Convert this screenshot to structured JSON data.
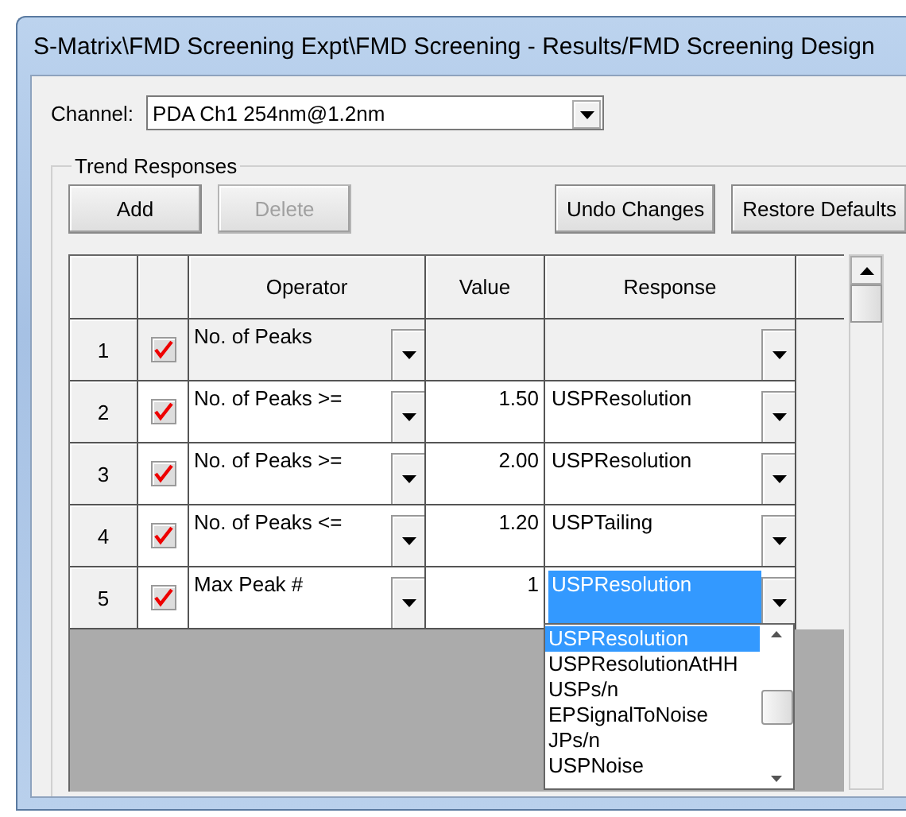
{
  "window": {
    "title": "S-Matrix\\FMD Screening Expt\\FMD Screening - Results/FMD Screening Design"
  },
  "channel": {
    "label": "Channel:",
    "value": "PDA Ch1 254nm@1.2nm"
  },
  "group": {
    "title": "Trend Responses"
  },
  "buttons": [
    {
      "label": "Add",
      "disabled": false
    },
    {
      "label": "Delete",
      "disabled": true
    },
    {
      "label": "Undo Changes",
      "disabled": false
    },
    {
      "label": "Restore Defaults",
      "disabled": false
    }
  ],
  "table": {
    "columns": [
      "Operator",
      "Value",
      "Response"
    ],
    "rows": [
      {
        "number": "1",
        "checked": true,
        "shaded": true,
        "operator": "No. of Peaks",
        "response_selected": false
      },
      {
        "number": "2",
        "checked": true,
        "shaded": false,
        "operator": "No. of Peaks >=",
        "value": "1.50",
        "response": "USPResolution",
        "response_selected": false
      },
      {
        "number": "3",
        "checked": true,
        "shaded": false,
        "operator": "No. of Peaks >=",
        "value": "2.00",
        "response": "USPResolution",
        "response_selected": false
      },
      {
        "number": "4",
        "checked": true,
        "shaded": false,
        "operator": "No. of Peaks <=",
        "value": "1.20",
        "response": "USPTailing",
        "response_selected": false
      },
      {
        "number": "5",
        "checked": true,
        "shaded": false,
        "operator": "Max Peak #",
        "value": "1",
        "response": "USPResolution",
        "response_selected": true
      }
    ]
  },
  "dropdown": {
    "options": [
      {
        "label": "USPResolution",
        "selected": true
      },
      {
        "label": "USPResolutionAtHH",
        "selected": false
      },
      {
        "label": "USPs/n",
        "selected": false
      },
      {
        "label": "EPSignalToNoise",
        "selected": false
      },
      {
        "label": "JPs/n",
        "selected": false
      },
      {
        "label": "USPNoise",
        "selected": false
      }
    ]
  }
}
